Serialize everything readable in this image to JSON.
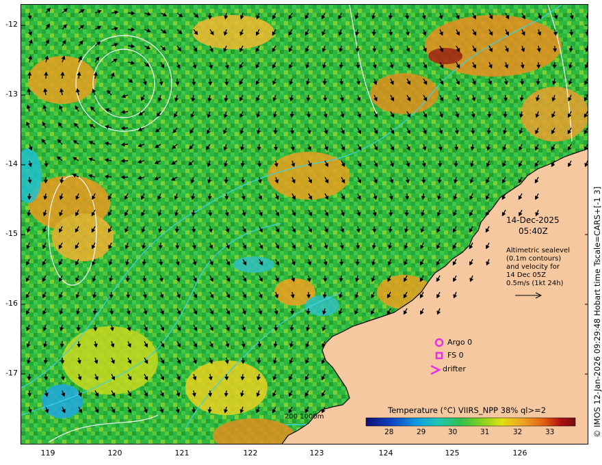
{
  "map": {
    "date_line": "14-Dec-2025",
    "time_line": "05:40Z",
    "altimetry_note": [
      "Altimetric sealevel",
      "(0.1m contours)",
      "and velocity for",
      "14 Dec 05Z",
      "0.5m/s (1kt 24h)"
    ],
    "legend": {
      "argo": "Argo 0",
      "fs": "FS 0",
      "drifter": "drifter",
      "argo_color": "#e62ee6"
    },
    "depth_label": "200  1000m",
    "depth_color": "#40d0e0",
    "colorbar": {
      "title": "Temperature (°C) VIIRS_NPP 38% ql>=2",
      "ticks": [
        "28",
        "29",
        "30",
        "31",
        "32",
        "33"
      ],
      "colors": [
        "#101078",
        "#1040c0",
        "#10a0e0",
        "#20c8b0",
        "#30c050",
        "#80d020",
        "#e0e010",
        "#f0a020",
        "#e06010",
        "#b01010",
        "#701010"
      ]
    },
    "lat_labels": [
      "-12",
      "-13",
      "-14",
      "-15",
      "-16",
      "-17"
    ],
    "lon_labels": [
      "119",
      "120",
      "121",
      "122",
      "123",
      "124",
      "125",
      "126"
    ],
    "credit": "© IMOS 12-Jan-2026 09:29:48 Hobart time Tscale=CARS+[-1 3]",
    "land_color": "#f5c8a0"
  }
}
